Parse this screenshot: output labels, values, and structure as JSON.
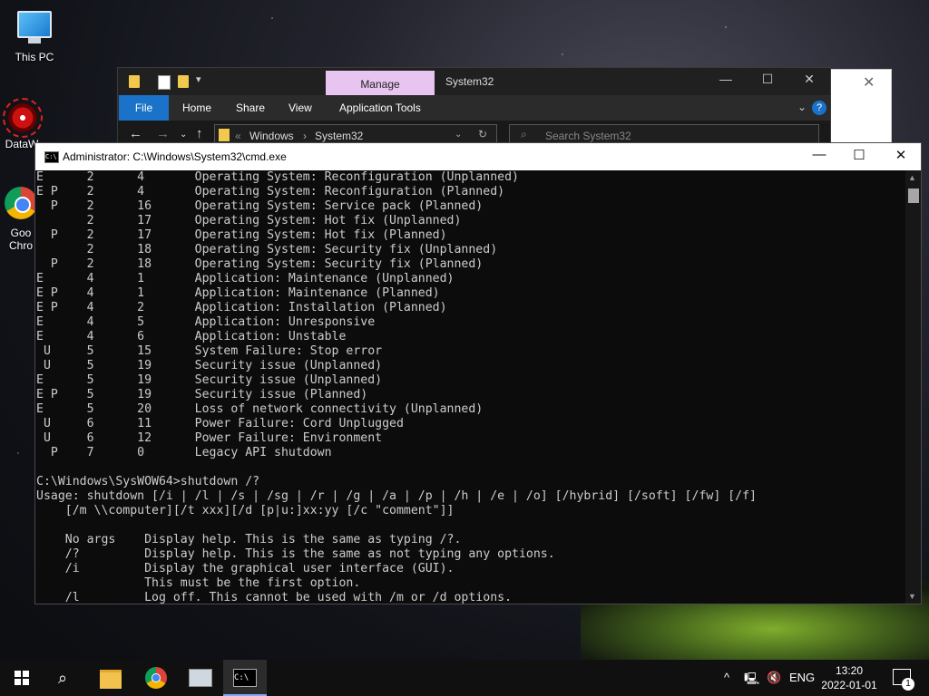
{
  "desktop": {
    "icons": [
      {
        "label": "This PC",
        "icon": "this-pc-icon"
      },
      {
        "label": "DataW",
        "icon": "datawarehouse-icon"
      },
      {
        "label": "Goo Chro",
        "icon": "chrome-icon"
      }
    ]
  },
  "explorer": {
    "contextual_tab": "Manage",
    "title": "System32",
    "ribbon_tabs": [
      "File",
      "Home",
      "Share",
      "View",
      "Application Tools"
    ],
    "breadcrumb": [
      "Windows",
      "System32"
    ],
    "search_placeholder": "Search System32"
  },
  "cmd": {
    "title": "Administrator: C:\\Windows\\System32\\cmd.exe",
    "lines": [
      "E      2      4       Operating System: Reconfiguration (Unplanned)",
      "E P    2      4       Operating System: Reconfiguration (Planned)",
      "  P    2      16      Operating System: Service pack (Planned)",
      "       2      17      Operating System: Hot fix (Unplanned)",
      "  P    2      17      Operating System: Hot fix (Planned)",
      "       2      18      Operating System: Security fix (Unplanned)",
      "  P    2      18      Operating System: Security fix (Planned)",
      "E      4      1       Application: Maintenance (Unplanned)",
      "E P    4      1       Application: Maintenance (Planned)",
      "E P    4      2       Application: Installation (Planned)",
      "E      4      5       Application: Unresponsive",
      "E      4      6       Application: Unstable",
      " U     5      15      System Failure: Stop error",
      " U     5      19      Security issue (Unplanned)",
      "E      5      19      Security issue (Unplanned)",
      "E P    5      19      Security issue (Planned)",
      "E      5      20      Loss of network connectivity (Unplanned)",
      " U     6      11      Power Failure: Cord Unplugged",
      " U     6      12      Power Failure: Environment",
      "  P    7      0       Legacy API shutdown",
      "",
      "C:\\Windows\\SysWOW64>shutdown /?",
      "Usage: shutdown [/i | /l | /s | /sg | /r | /g | /a | /p | /h | /e | /o] [/hybrid] [/soft] [/fw] [/f]",
      "    [/m \\\\computer][/t xxx][/d [p|u:]xx:yy [/c \"comment\"]]",
      "",
      "    No args    Display help. This is the same as typing /?.",
      "    /?         Display help. This is the same as not typing any options.",
      "    /i         Display the graphical user interface (GUI).",
      "               This must be the first option.",
      "    /l         Log off. This cannot be used with /m or /d options."
    ]
  },
  "taskbar": {
    "language": "ENG",
    "time": "13:20",
    "date": "2022-01-01",
    "notification_count": "1"
  }
}
